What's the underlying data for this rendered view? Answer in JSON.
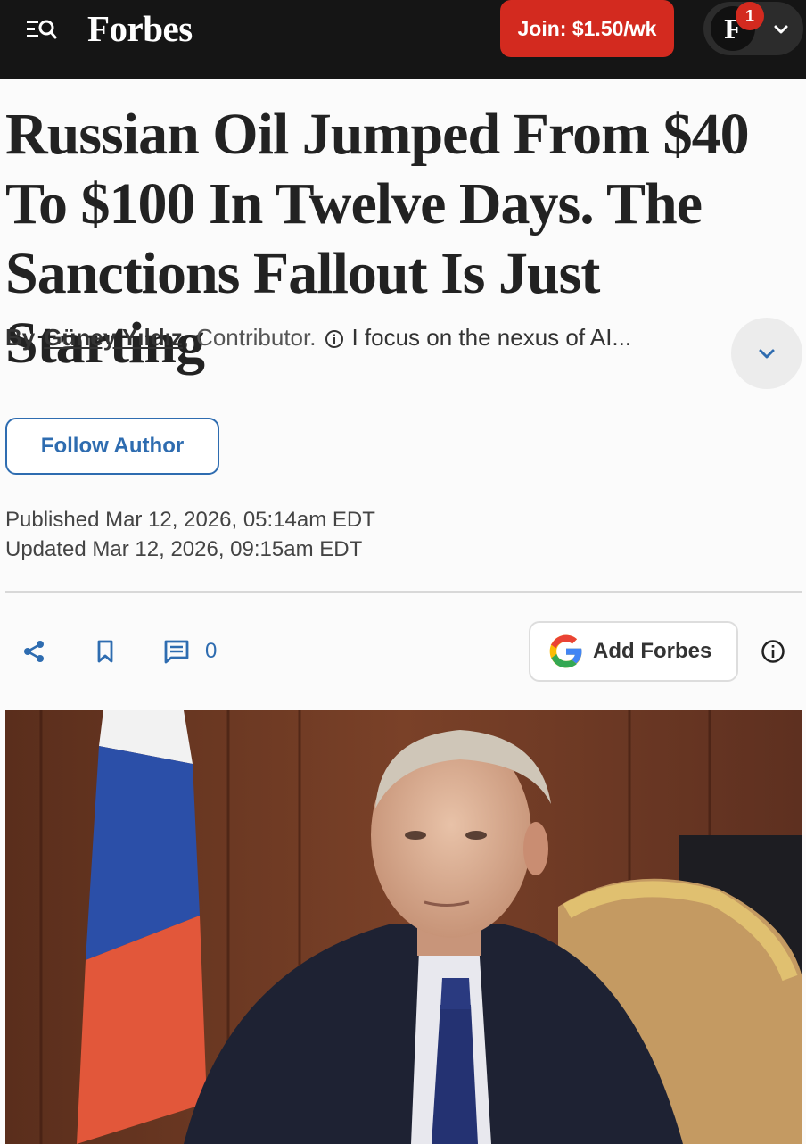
{
  "header": {
    "logo": "Forbes",
    "join_label": "Join: $1.50/wk",
    "avatar_letter": "F",
    "notification_count": "1",
    "brand_red": "#d32a1f"
  },
  "article": {
    "headline": "Russian Oil Jumped From $40 To $100 In Twelve Days. The Sanctions Fallout Is Just Starting",
    "by_label": "By",
    "author": "Güney Yıldız",
    "comma": ",",
    "role": "Contributor.",
    "bio": "I focus on the nexus of AI...",
    "follow_label": "Follow Author",
    "published": "Published Mar 12, 2026, 05:14am EDT",
    "updated": "Updated Mar 12, 2026, 09:15am EDT"
  },
  "actions": {
    "comment_count": "0",
    "add_forbes_label": "Add Forbes",
    "accent": "#2e6cb0"
  }
}
